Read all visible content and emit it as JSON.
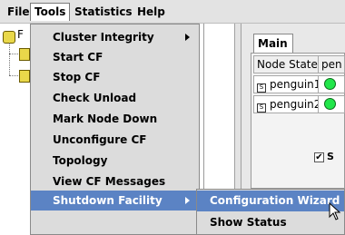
{
  "menubar": {
    "items": [
      {
        "label": "File"
      },
      {
        "label": "Tools"
      },
      {
        "label": "Statistics"
      },
      {
        "label": "Help"
      }
    ]
  },
  "tree": {
    "root_label": "F"
  },
  "tools_menu": {
    "items": [
      {
        "label": "Cluster Integrity",
        "has_submenu": true
      },
      {
        "label": "Start CF"
      },
      {
        "label": "Stop CF"
      },
      {
        "label": "Check Unload"
      },
      {
        "label": "Mark Node Down"
      },
      {
        "label": "Unconfigure CF"
      },
      {
        "label": "Topology"
      },
      {
        "label": "View CF Messages"
      },
      {
        "label": "Shutdown Facility",
        "has_submenu": true,
        "highlighted": true
      }
    ]
  },
  "submenu": {
    "items": [
      {
        "label": "Configuration Wizard",
        "highlighted": true
      },
      {
        "label": "Show Status"
      }
    ]
  },
  "main_panel": {
    "tab_label": "Main",
    "headers": [
      "Node States",
      "pen"
    ],
    "rows": [
      {
        "node": "penguin1",
        "state_color": "#21e64a"
      },
      {
        "node": "penguin2",
        "state_color": "#21e64a"
      }
    ],
    "checkbox_label": "S",
    "checkbox_checked": true
  },
  "colors": {
    "menu_highlight": "#5b83c4",
    "menu_bg": "#dcdcdc"
  }
}
